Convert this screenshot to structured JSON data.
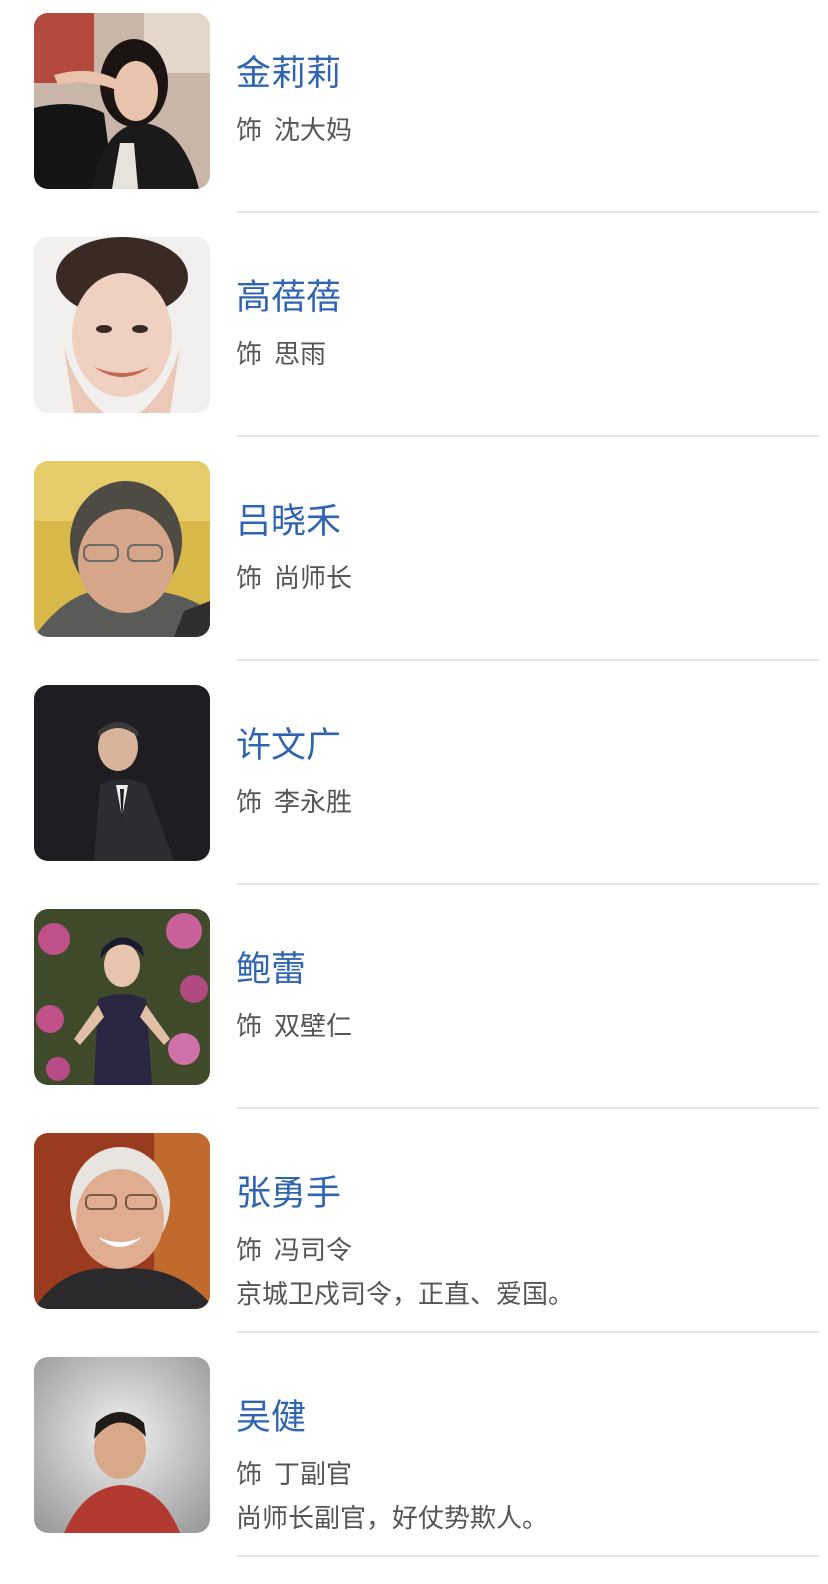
{
  "role_prefix": "饰",
  "cast": [
    {
      "actor": "金莉莉",
      "role": "沈大妈",
      "description": ""
    },
    {
      "actor": "高蓓蓓",
      "role": "思雨",
      "description": ""
    },
    {
      "actor": "吕晓禾",
      "role": "尚师长",
      "description": ""
    },
    {
      "actor": "许文广",
      "role": "李永胜",
      "description": ""
    },
    {
      "actor": "鲍蕾",
      "role": "双壁仁",
      "description": ""
    },
    {
      "actor": "张勇手",
      "role": "冯司令",
      "description": "京城卫戍司令，正直、爱国。"
    },
    {
      "actor": "吴健",
      "role": "丁副官",
      "description": "尚师长副官，好仗势欺人。"
    }
  ]
}
